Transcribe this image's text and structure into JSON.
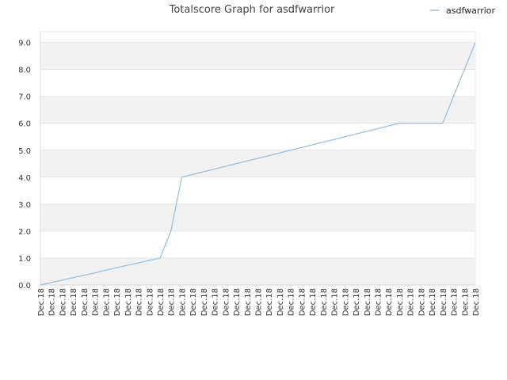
{
  "chart_data": {
    "type": "line",
    "title": "Totalscore Graph for asdfwarrior",
    "xlabel": "",
    "ylabel": "",
    "ylim": [
      0,
      9.4
    ],
    "grid": "horizontal alternating bands",
    "legend": "top-right",
    "y_ticks": [
      "0.0",
      "1.0",
      "2.0",
      "3.0",
      "4.0",
      "5.0",
      "6.0",
      "7.0",
      "8.0",
      "9.0"
    ],
    "categories": [
      "Dec.18",
      "Dec.18",
      "Dec.18",
      "Dec.18",
      "Dec.18",
      "Dec.18",
      "Dec.18",
      "Dec.18",
      "Dec.18",
      "Dec.18",
      "Dec.18",
      "Dec.18",
      "Dec.18",
      "Dec.18",
      "Dec.18",
      "Dec.18",
      "Dec.18",
      "Dec.18",
      "Dec.18",
      "Dec.18",
      "Dec.18",
      "Dec.18",
      "Dec.18",
      "Dec.18",
      "Dec.18",
      "Dec.18",
      "Dec.18",
      "Dec.18",
      "Dec.18",
      "Dec.18",
      "Dec.18",
      "Dec.18",
      "Dec.18",
      "Dec.18",
      "Dec.18",
      "Dec.18",
      "Dec.18",
      "Dec.18",
      "Dec.18",
      "Dec.18",
      "Dec.18"
    ],
    "series": [
      {
        "name": "asdfwarrior",
        "color": "#8fc3ea",
        "values": [
          0,
          0.09,
          0.18,
          0.27,
          0.36,
          0.45,
          0.55,
          0.64,
          0.73,
          0.82,
          0.91,
          1,
          2,
          4,
          4.1,
          4.2,
          4.3,
          4.4,
          4.5,
          4.6,
          4.7,
          4.8,
          4.9,
          5.0,
          5.1,
          5.2,
          5.3,
          5.4,
          5.5,
          5.6,
          5.7,
          5.8,
          5.9,
          6,
          6,
          6,
          6,
          6,
          7,
          8,
          9
        ]
      }
    ]
  },
  "colors": {
    "band": "#f2f2f2",
    "grid": "#dddddd",
    "line": "#8fc3ea"
  }
}
